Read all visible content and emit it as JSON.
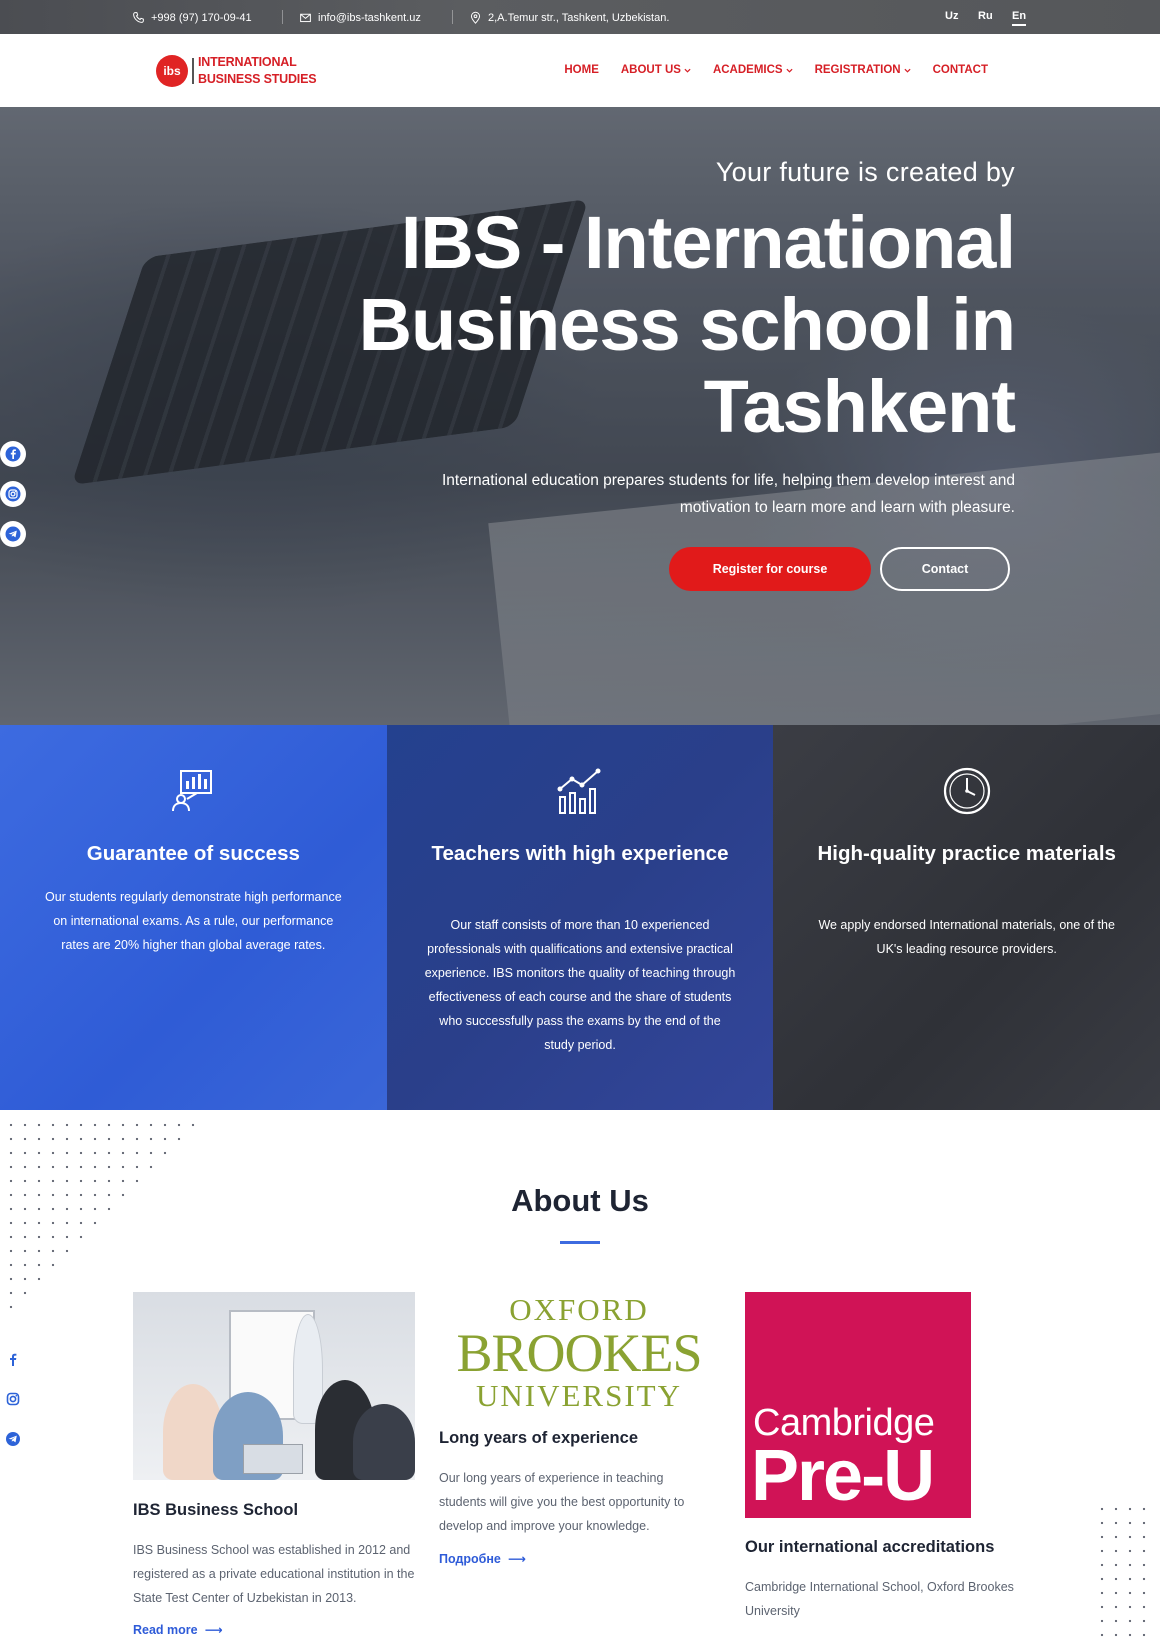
{
  "topbar": {
    "phone": "+998 (97) 170-09-41",
    "email": "info@ibs-tashkent.uz",
    "address": "2,A.Temur str., Tashkent, Uzbekistan.",
    "languages": [
      "Uz",
      "Ru",
      "En"
    ],
    "active_language": "En"
  },
  "header": {
    "logo_mark": "ibs",
    "logo_line1": "INTERNATIONAL",
    "logo_line2": "BUSINESS STUDIES",
    "nav": [
      {
        "label": "HOME",
        "dropdown": false
      },
      {
        "label": "ABOUT US",
        "dropdown": true
      },
      {
        "label": "ACADEMICS",
        "dropdown": true
      },
      {
        "label": "REGISTRATION",
        "dropdown": true
      },
      {
        "label": "CONTACT",
        "dropdown": false
      }
    ]
  },
  "hero": {
    "subtitle": "Your future is created by",
    "title": "IBS - International Business school in Tashkent",
    "description": "International education prepares students for life, helping them develop interest and motivation to learn more and learn with pleasure.",
    "primary_button": "Register for course",
    "secondary_button": "Contact"
  },
  "social": [
    "facebook-icon",
    "instagram-icon",
    "telegram-icon"
  ],
  "features": [
    {
      "icon": "presentation-chart-icon",
      "title": "Guarantee of success",
      "text": "Our students regularly demonstrate high performance on international exams. As a rule, our performance rates are 20% higher than global average rates."
    },
    {
      "icon": "growth-chart-icon",
      "title": "Teachers with high experience",
      "text": "Our staff consists of more than 10 experienced professionals with qualifications and extensive practical experience. IBS monitors the quality of teaching through effectiveness of each course and the share of students who successfully pass the exams by the end of the study period."
    },
    {
      "icon": "clock-icon",
      "title": "High-quality practice materials",
      "text": "We apply endorsed International materials, one of the UK's leading resource providers."
    }
  ],
  "about": {
    "title": "About Us",
    "cards": [
      {
        "title": "IBS Business School",
        "text": "IBS Business School was established in 2012 and registered as a private educational institution in the State Test Center of Uzbekistan in 2013.",
        "link": "Read more"
      },
      {
        "logo_lines": [
          "OXFORD",
          "BROOKES",
          "UNIVERSITY"
        ],
        "title": "Long years of experience",
        "text": "Our long years of experience in teaching students will give you the best opportunity to develop and improve your knowledge.",
        "link": "Подробне"
      },
      {
        "logo_lines": [
          "Cambridge",
          "Pre-U"
        ],
        "title": "Our international accreditations",
        "text": "Cambridge International School, Oxford Brookes University"
      }
    ]
  },
  "colors": {
    "brand_red": "#d61f26",
    "button_red": "#e11a1a",
    "accent_blue": "#2e5bd8",
    "oxford_green": "#8aa232",
    "cambridge_pink": "#d01356"
  }
}
